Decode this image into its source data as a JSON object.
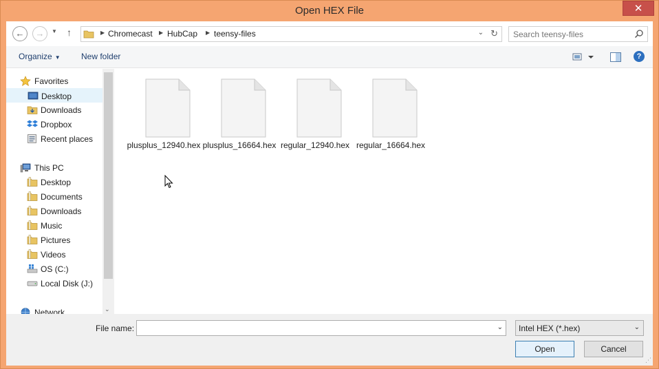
{
  "window": {
    "title": "Open HEX File",
    "close_glyph": "✕"
  },
  "navigation": {
    "back_glyph": "←",
    "forward_glyph": "→",
    "recent_glyph": "▼",
    "up_glyph": "↑",
    "breadcrumbs": [
      "Chromecast",
      "HubCap",
      "teensy-files"
    ],
    "breadcrumb_separator": "▶",
    "dropdown_glyph": "⌄",
    "refresh_glyph": "↻",
    "search_placeholder": "Search teensy-files"
  },
  "toolbar": {
    "organize_label": "Organize",
    "organize_caret": "▼",
    "new_folder_label": "New folder",
    "help_glyph": "?"
  },
  "nav_pane": {
    "items": [
      {
        "label": "Favorites",
        "icon": "star-icon",
        "level": 0
      },
      {
        "label": "Desktop",
        "icon": "desktop-icon",
        "level": 1,
        "selected": true
      },
      {
        "label": "Downloads",
        "icon": "downloads-folder-icon",
        "level": 1
      },
      {
        "label": "Dropbox",
        "icon": "dropbox-icon",
        "level": 1
      },
      {
        "label": "Recent places",
        "icon": "recent-places-icon",
        "level": 1
      },
      {
        "label": "This PC",
        "icon": "computer-icon",
        "level": 0
      },
      {
        "label": "Desktop",
        "icon": "folder-icon",
        "level": 1
      },
      {
        "label": "Documents",
        "icon": "folder-icon",
        "level": 1
      },
      {
        "label": "Downloads",
        "icon": "folder-icon",
        "level": 1
      },
      {
        "label": "Music",
        "icon": "folder-icon",
        "level": 1
      },
      {
        "label": "Pictures",
        "icon": "folder-icon",
        "level": 1
      },
      {
        "label": "Videos",
        "icon": "folder-icon",
        "level": 1
      },
      {
        "label": "OS (C:)",
        "icon": "os-drive-icon",
        "level": 1
      },
      {
        "label": "Local Disk (J:)",
        "icon": "drive-icon",
        "level": 1
      },
      {
        "label": "Network",
        "icon": "network-icon",
        "level": 0
      }
    ],
    "scroll_down_glyph": "⌄"
  },
  "files": [
    {
      "name": "plusplus_12940.hex"
    },
    {
      "name": "plusplus_16664.hex"
    },
    {
      "name": "regular_12940.hex"
    },
    {
      "name": "regular_16664.hex"
    }
  ],
  "footer": {
    "filename_label": "File name:",
    "filename_value": "",
    "filename_caret": "⌄",
    "filetype_value": "Intel HEX (*.hex)",
    "filetype_caret": "⌄",
    "open_label": "Open",
    "cancel_label": "Cancel",
    "grip_glyph": "⋰"
  },
  "colors": {
    "title_bar": "#f5a571",
    "close_button": "#c7504a",
    "selection": "#e5f3fb",
    "open_button_border": "#3c7fb1"
  }
}
